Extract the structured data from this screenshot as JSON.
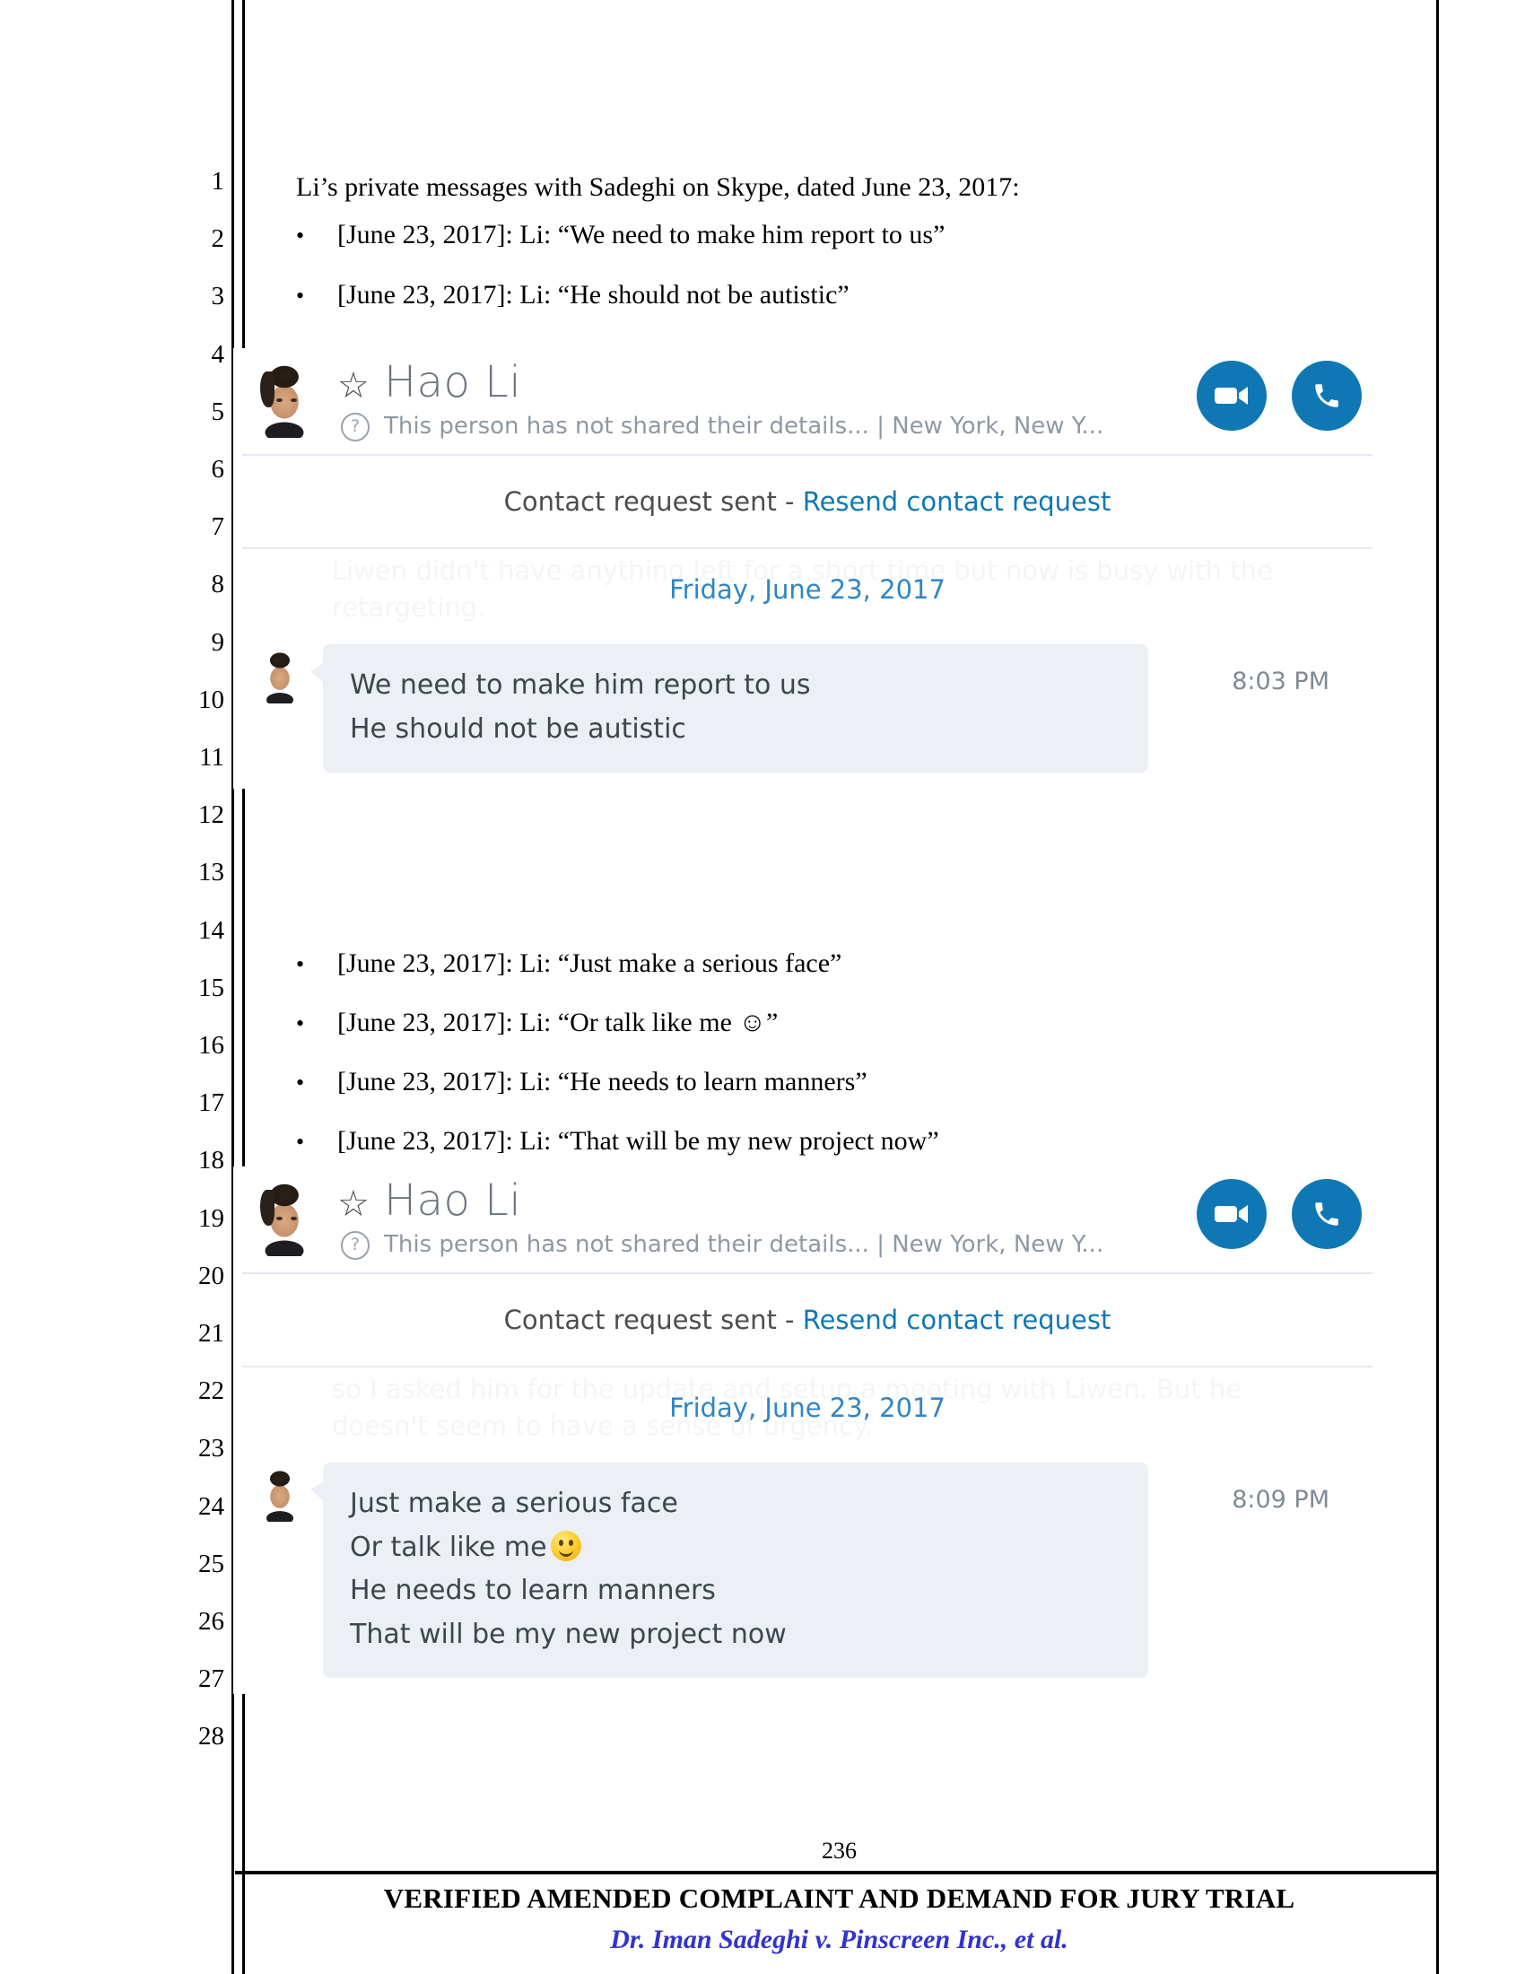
{
  "document": {
    "line_numbers": [
      "1",
      "2",
      "3",
      "4",
      "5",
      "6",
      "7",
      "8",
      "9",
      "10",
      "11",
      "12",
      "13",
      "14",
      "15",
      "16",
      "17",
      "18",
      "19",
      "20",
      "21",
      "22",
      "23",
      "24",
      "25",
      "26",
      "27",
      "28"
    ],
    "heading": "Li’s private messages with Sadeghi on Skype, dated June 23, 2017:",
    "bullet_marker": "•",
    "bullets_group_1": [
      "[June 23, 2017]: Li: “We need to make him report to us”",
      "[June 23, 2017]: Li: “He should not be autistic”"
    ],
    "bullets_group_2": [
      "[June 23, 2017]: Li: “Just make a serious face”",
      "[June 23, 2017]: Li: “Or talk like me ☺”",
      "[June 23, 2017]: Li: “He needs to learn manners”",
      "[June 23, 2017]: Li: “That will be my new project now”"
    ]
  },
  "skype_1": {
    "contact_name": "Hao Li",
    "status_line": "This person has not shared their details...  |  New York, New Y...",
    "question_icon": "?",
    "star_icon": "☆",
    "request_text": "Contact request sent - ",
    "request_link": "Resend contact request",
    "ghost_text": "Liwen didn't have anything left for a short time but now is busy with the retargeting.",
    "date_divider": "Friday, June 23, 2017",
    "messages": [
      "We need to make him report to us",
      "He should not be autistic"
    ],
    "timestamp": "8:03 PM"
  },
  "skype_2": {
    "contact_name": "Hao Li",
    "status_line": "This person has not shared their details...  |  New York, New Y...",
    "question_icon": "?",
    "star_icon": "☆",
    "request_text": "Contact request sent - ",
    "request_link": "Resend contact request",
    "ghost_text": "so I asked him for the update and setup a meeting with Liwen. But he doesn't seem to have a sense of urgency.",
    "date_divider": "Friday, June 23, 2017",
    "messages_a": "Just make a serious face",
    "messages_b": "Or talk like me",
    "messages_c": "He needs to learn manners",
    "messages_d": "That will be my new project now",
    "timestamp": "8:09 PM"
  },
  "footer": {
    "page_number": "236",
    "title": "VERIFIED AMENDED COMPLAINT AND DEMAND FOR JURY TRIAL",
    "case_caption": "Dr. Iman Sadeghi v. Pinscreen Inc., et al."
  },
  "colors": {
    "skype_blue": "#0f78b4",
    "link_blue": "#2f86c5",
    "case_blue": "#3333cc"
  }
}
